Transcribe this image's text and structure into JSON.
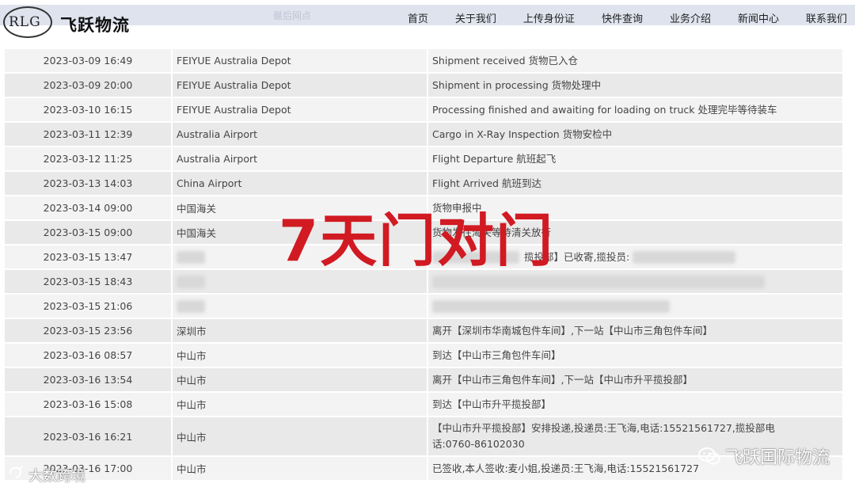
{
  "header": {
    "logo_ring_text": "RLG",
    "brand": "飞跃物流",
    "faded_column": "最后网点",
    "nav": [
      "首页",
      "关于我们",
      "上传身份证",
      "快件查询",
      "业务介绍",
      "新闻中心",
      "联系我们"
    ]
  },
  "rows": [
    {
      "time": "2023-03-09 16:49",
      "location": "FEIYUE Australia Depot",
      "desc": "Shipment received 货物已入仓"
    },
    {
      "time": "2023-03-09 20:00",
      "location": "FEIYUE Australia Depot",
      "desc": "Shipment in processing 货物处理中"
    },
    {
      "time": "2023-03-10 16:15",
      "location": "FEIYUE Australia Depot",
      "desc": "Processing finished and awaiting for loading on truck 处理完毕等待装车"
    },
    {
      "time": "2023-03-11 12:39",
      "location": "Australia Airport",
      "desc": "Cargo in X-Ray Inspection 货物安检中"
    },
    {
      "time": "2023-03-12 11:25",
      "location": "Australia Airport",
      "desc": "Flight Departure 航班起飞"
    },
    {
      "time": "2023-03-13 14:03",
      "location": "China Airport",
      "desc": "Flight Arrived 航班到达"
    },
    {
      "time": "2023-03-14 09:00",
      "location": "中国海关",
      "desc": "货物申报中"
    },
    {
      "time": "2023-03-15 09:00",
      "location": "中国海关",
      "desc": "货物发往海关等待清关放行"
    },
    {
      "time": "2023-03-15 13:47",
      "location": "",
      "desc": "揽投部】已收寄,揽投员:"
    },
    {
      "time": "2023-03-15 18:43",
      "location": "",
      "desc": ""
    },
    {
      "time": "2023-03-15 21:06",
      "location": "",
      "desc": ""
    },
    {
      "time": "2023-03-15 23:56",
      "location": "深圳市",
      "desc": "离开【深圳市华南城包件车间】,下一站【中山市三角包件车间】"
    },
    {
      "time": "2023-03-16 08:57",
      "location": "中山市",
      "desc": "到达【中山市三角包件车间】"
    },
    {
      "time": "2023-03-16 13:54",
      "location": "中山市",
      "desc": "离开【中山市三角包件车间】,下一站【中山市升平揽投部】"
    },
    {
      "time": "2023-03-16 15:08",
      "location": "中山市",
      "desc": "到达【中山市升平揽投部】"
    },
    {
      "time": "2023-03-16 16:21",
      "location": "中山市",
      "desc": "【中山市升平揽投部】安排投递,投递员:王飞海,电话:15521561727,揽投部电话:0760-86102030"
    },
    {
      "time": "2023-03-16 17:00",
      "location": "中山市",
      "desc": "已签收,本人签收:麦小姐,投递员:王飞海,电话:15521561727"
    }
  ],
  "overlay": {
    "promo": "7天门对门",
    "watermark_right": "飞跃国际物流",
    "watermark_left": "大数跨境"
  }
}
